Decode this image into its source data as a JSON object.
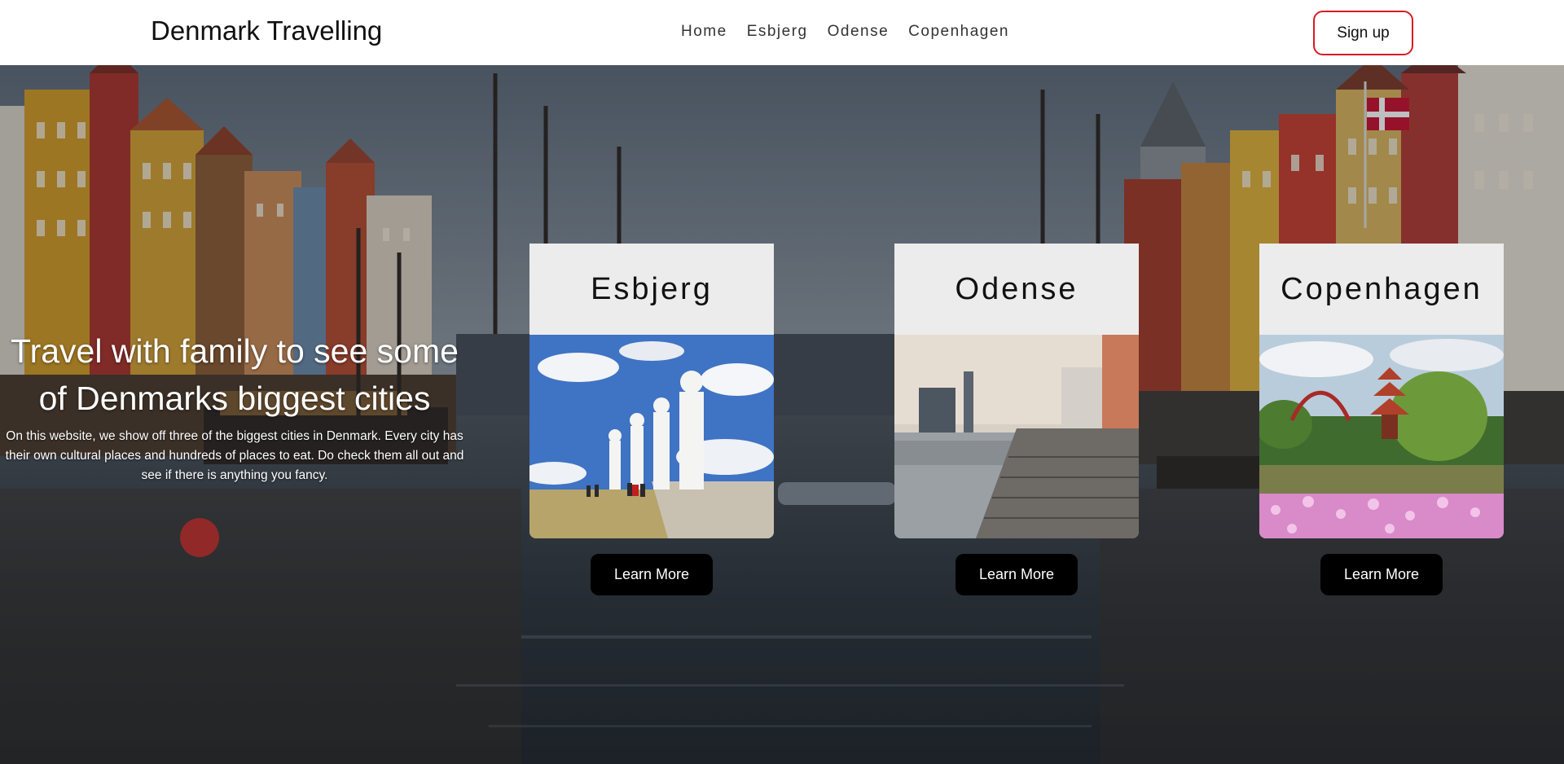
{
  "header": {
    "brand": "Denmark Travelling",
    "nav": [
      "Home",
      "Esbjerg",
      "Odense",
      "Copenhagen"
    ],
    "signup_label": "Sign up"
  },
  "hero": {
    "heading_line1": "Travel with family to see some",
    "heading_line2": "of Denmarks biggest cities",
    "description_line1": "On this website, we show off three of the biggest cities in Denmark. Every city has",
    "description_line2": "their own cultural places and hundreds of places to eat. Do check them all out and",
    "description_line3": "see if there is anything you fancy."
  },
  "cards": [
    {
      "title": "Esbjerg",
      "button": "Learn More"
    },
    {
      "title": "Odense",
      "button": "Learn More"
    },
    {
      "title": "Copenhagen",
      "button": "Learn More"
    }
  ],
  "colors": {
    "accent": "#d81b24",
    "button_bg": "#000000",
    "card_title_bg": "#ececec",
    "header_bg": "#ffffff"
  }
}
